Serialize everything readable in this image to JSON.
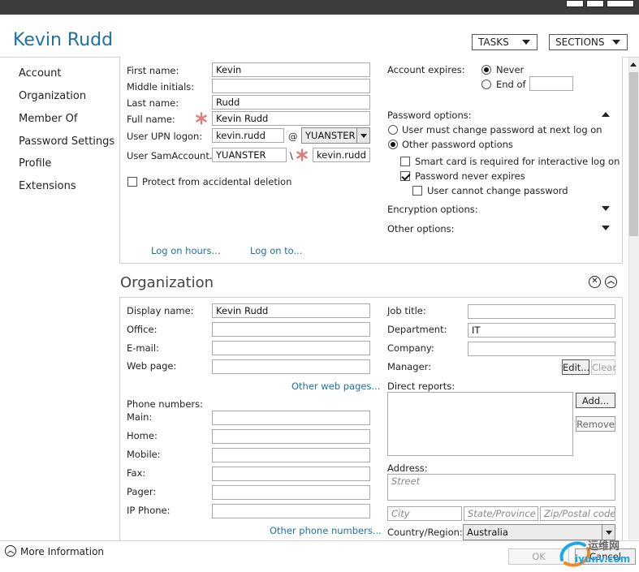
{
  "header": {
    "title": "Kevin Rudd",
    "tasks_label": "TASKS",
    "sections_label": "SECTIONS"
  },
  "nav": {
    "items": [
      {
        "label": "Account"
      },
      {
        "label": "Organization"
      },
      {
        "label": "Member Of"
      },
      {
        "label": "Password Settings"
      },
      {
        "label": "Profile"
      },
      {
        "label": "Extensions"
      }
    ]
  },
  "account": {
    "first_name_label": "First name:",
    "first_name_value": "Kevin",
    "middle_initials_label": "Middle initials:",
    "middle_initials_value": "",
    "last_name_label": "Last name:",
    "last_name_value": "Rudd",
    "full_name_label": "Full name:",
    "full_name_value": "Kevin Rudd",
    "upn_label": "User UPN logon:",
    "upn_value": "kevin.rudd",
    "at_sign": "@",
    "upn_domain": "YUANSTER",
    "sam_label": "User SamAccount...",
    "sam_domain": "YUANSTER",
    "backslash": "\\",
    "sam_value": "kevin.rudd",
    "protect_label": "Protect from accidental deletion",
    "logon_hours_link": "Log on hours...",
    "logon_to_link": "Log on to...",
    "expires_label": "Account expires:",
    "never_label": "Never",
    "end_of_label": "End of",
    "end_of_value": "",
    "password_options_label": "Password options:",
    "must_change_label": "User must change password at next log on",
    "other_pw_options_label": "Other password options",
    "smart_card_label": "Smart card is required for interactive log on",
    "never_expires_label": "Password never expires",
    "cannot_change_label": "User cannot change password",
    "encryption_label": "Encryption options:",
    "other_options_label": "Other options:"
  },
  "organization": {
    "title": "Organization",
    "display_name_label": "Display name:",
    "display_name_value": "Kevin Rudd",
    "office_label": "Office:",
    "office_value": "",
    "email_label": "E-mail:",
    "email_value": "",
    "web_page_label": "Web page:",
    "web_page_value": "",
    "other_web_pages_link": "Other web pages...",
    "phone_numbers_label": "Phone numbers:",
    "main_label": "Main:",
    "home_label": "Home:",
    "mobile_label": "Mobile:",
    "fax_label": "Fax:",
    "pager_label": "Pager:",
    "ip_phone_label": "IP Phone:",
    "other_phone_link": "Other phone numbers...",
    "job_title_label": "Job title:",
    "job_title_value": "",
    "department_label": "Department:",
    "department_value": "IT",
    "company_label": "Company:",
    "company_value": "",
    "manager_label": "Manager:",
    "edit_label": "Edit...",
    "clear_label": "Clear",
    "direct_reports_label": "Direct reports:",
    "add_label": "Add...",
    "remove_label": "Remove",
    "address_label": "Address:",
    "street_placeholder": "Street",
    "city_placeholder": "City",
    "state_placeholder": "State/Province",
    "zip_placeholder": "Zip/Postal code",
    "country_label": "Country/Region:",
    "country_value": "Australia"
  },
  "footer": {
    "more_info_label": "More Information",
    "ok_label": "OK",
    "cancel_label": "Cancel",
    "watermark_text": "运维网",
    "watermark_sub": "iyunv.com"
  },
  "colors": {
    "accent": "#1d6fa5",
    "required": "#e07a7a",
    "titlebar": "#3d3d3d"
  }
}
